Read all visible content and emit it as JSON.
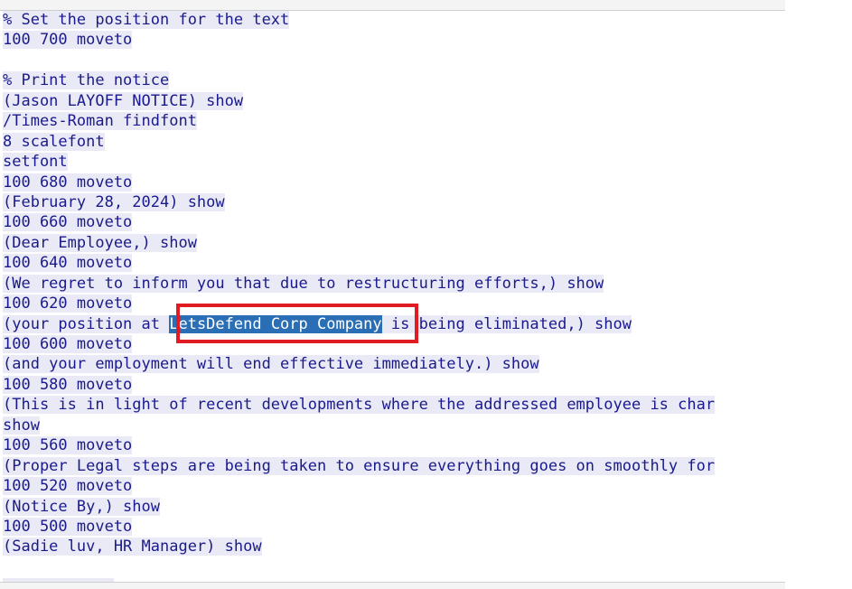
{
  "lines": [
    "% Set the position for the text",
    "100 700 moveto",
    "",
    "% Print the notice",
    "(Jason LAYOFF NOTICE) show",
    "/Times-Roman findfont",
    "8 scalefont",
    "setfont",
    "100 680 moveto",
    "(February 28, 2024) show",
    "100 660 moveto",
    "(Dear Employee,) show",
    "100 640 moveto",
    "(We regret to inform you that due to restructuring efforts,) show",
    "100 620 moveto",
    "(your position at ",
    "100 600 moveto",
    "(and your employment will end effective immediately.) show",
    "100 580 moveto",
    "(This is in light of recent developments where the addressed employee is char",
    "show",
    "100 560 moveto",
    "(Proper Legal steps are being taken to ensure everything goes on smoothly for",
    "100 520 moveto",
    "(Notice By,) show",
    "100 500 moveto",
    "(Sadie luv, HR Manager) show",
    "",
    "  ...  ...  "
  ],
  "selection": {
    "before": "(your position at ",
    "selected": "LetsDefend Corp Company",
    "after": " is being eliminated,) show"
  }
}
